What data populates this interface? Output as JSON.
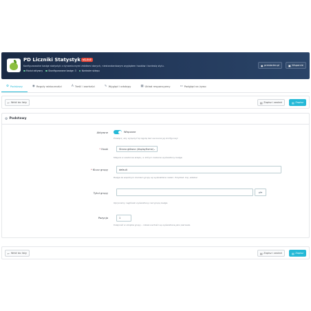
{
  "header": {
    "title": "PD Liczniki Statystyk Pro",
    "version": "v1.0.0",
    "description": "Konfigurowalne badge statystyk z dynamicznymi źródłami danych, niestandardowym wyglądem hooków i kontrolą stylu.",
    "features": [
      "Moduł aktywny",
      "Skonfigurowane badge: 3",
      "Kontroler sklepu"
    ],
    "buttons": {
      "vendor": "prestadev.pl",
      "support": "Wsparcie"
    }
  },
  "tabs": [
    {
      "label": "Podstawy",
      "icon": "gear-icon",
      "active": true
    },
    {
      "label": "Reguły widoczności",
      "icon": "eye-icon",
      "active": false
    },
    {
      "label": "Treść i wartości",
      "icon": "text-icon",
      "active": false
    },
    {
      "label": "Wygląd i odstępy",
      "icon": "brush-icon",
      "active": false
    },
    {
      "label": "Układ responsywny",
      "icon": "grid-icon",
      "active": false
    },
    {
      "label": "Podgląd na żywo",
      "icon": "monitor-icon",
      "active": false
    }
  ],
  "toolbar": {
    "back_label": "Wróć do listy",
    "stay_label": "Zapisz i zostań",
    "save_label": "Zapisz"
  },
  "panel": {
    "title": "Podstawy",
    "fields": {
      "active": {
        "label": "Aktywne",
        "value_label": "Włączone",
        "help": "Przełącz, aby wyłączyć tę regułę bez usuwania jej konfiguracji."
      },
      "hook": {
        "label": "Hook",
        "value": "Strona główna (displayHome)",
        "help": "Miejsce w szablonie sklepu, w którym zostanie wyświetlony badge."
      },
      "group_key": {
        "label": "Klucz grupy",
        "value": "default",
        "help": "Badge ze wspólnym kluczem grupy są wyświetlane razem. Przykład: top, sidebar."
      },
      "group_title": {
        "label": "Tytuł grupy",
        "value": "",
        "help": "Opcjonalny nagłówek wyświetlany nad grupą badge."
      },
      "position": {
        "label": "Pozycja",
        "value": "1",
        "help": "Kolejność w obrębie grupy – niższe wartości są wyświetlane jako pierwsze."
      }
    }
  }
}
